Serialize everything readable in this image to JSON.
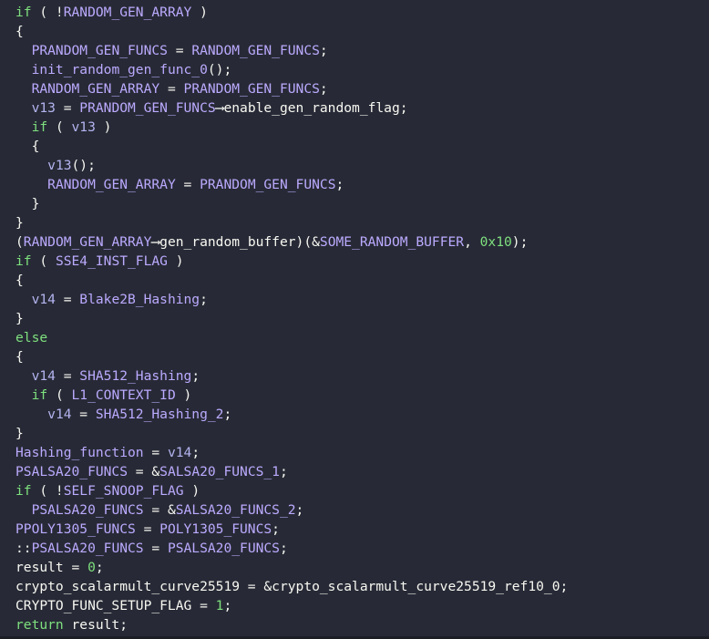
{
  "code": {
    "lines": [
      [
        {
          "t": "if",
          "c": "kw"
        },
        {
          "t": " ( !",
          "c": "pl"
        },
        {
          "t": "RANDOM_GEN_ARRAY",
          "c": "gv"
        },
        {
          "t": " )",
          "c": "pl"
        }
      ],
      [
        {
          "t": "{",
          "c": "pl"
        }
      ],
      [
        {
          "t": "  ",
          "c": "pl"
        },
        {
          "t": "PRANDOM_GEN_FUNCS",
          "c": "gv"
        },
        {
          "t": " = ",
          "c": "pl"
        },
        {
          "t": "RANDOM_GEN_FUNCS",
          "c": "gv"
        },
        {
          "t": ";",
          "c": "pl"
        }
      ],
      [
        {
          "t": "  ",
          "c": "pl"
        },
        {
          "t": "init_random_gen_func_0",
          "c": "gv"
        },
        {
          "t": "();",
          "c": "pl"
        }
      ],
      [
        {
          "t": "  ",
          "c": "pl"
        },
        {
          "t": "RANDOM_GEN_ARRAY",
          "c": "gv"
        },
        {
          "t": " = ",
          "c": "pl"
        },
        {
          "t": "PRANDOM_GEN_FUNCS",
          "c": "gv"
        },
        {
          "t": ";",
          "c": "pl"
        }
      ],
      [
        {
          "t": "  ",
          "c": "pl"
        },
        {
          "t": "v13",
          "c": "lv"
        },
        {
          "t": " = ",
          "c": "pl"
        },
        {
          "t": "PRANDOM_GEN_FUNCS",
          "c": "gv"
        },
        {
          "t": "⟶enable_gen_random_flag;",
          "c": "pl"
        }
      ],
      [
        {
          "t": "  ",
          "c": "pl"
        },
        {
          "t": "if",
          "c": "kw"
        },
        {
          "t": " ( ",
          "c": "pl"
        },
        {
          "t": "v13",
          "c": "lv"
        },
        {
          "t": " )",
          "c": "pl"
        }
      ],
      [
        {
          "t": "  {",
          "c": "pl"
        }
      ],
      [
        {
          "t": "    ",
          "c": "pl"
        },
        {
          "t": "v13",
          "c": "lv"
        },
        {
          "t": "();",
          "c": "pl"
        }
      ],
      [
        {
          "t": "    ",
          "c": "pl"
        },
        {
          "t": "RANDOM_GEN_ARRAY",
          "c": "gv"
        },
        {
          "t": " = ",
          "c": "pl"
        },
        {
          "t": "PRANDOM_GEN_FUNCS",
          "c": "gv"
        },
        {
          "t": ";",
          "c": "pl"
        }
      ],
      [
        {
          "t": "  }",
          "c": "pl"
        }
      ],
      [
        {
          "t": "}",
          "c": "pl"
        }
      ],
      [
        {
          "t": "(",
          "c": "pl"
        },
        {
          "t": "RANDOM_GEN_ARRAY",
          "c": "gv"
        },
        {
          "t": "⟶gen_random_buffer)(&",
          "c": "pl"
        },
        {
          "t": "SOME_RANDOM_BUFFER",
          "c": "gv"
        },
        {
          "t": ", ",
          "c": "pl"
        },
        {
          "t": "0x10",
          "c": "num"
        },
        {
          "t": ");",
          "c": "pl"
        }
      ],
      [
        {
          "t": "if",
          "c": "kw"
        },
        {
          "t": " ( ",
          "c": "pl"
        },
        {
          "t": "SSE4_INST_FLAG",
          "c": "gv"
        },
        {
          "t": " )",
          "c": "pl"
        }
      ],
      [
        {
          "t": "{",
          "c": "pl"
        }
      ],
      [
        {
          "t": "  ",
          "c": "pl"
        },
        {
          "t": "v14",
          "c": "lv"
        },
        {
          "t": " = ",
          "c": "pl"
        },
        {
          "t": "Blake2B_Hashing",
          "c": "gv"
        },
        {
          "t": ";",
          "c": "pl"
        }
      ],
      [
        {
          "t": "}",
          "c": "pl"
        }
      ],
      [
        {
          "t": "else",
          "c": "kw"
        }
      ],
      [
        {
          "t": "{",
          "c": "pl"
        }
      ],
      [
        {
          "t": "  ",
          "c": "pl"
        },
        {
          "t": "v14",
          "c": "lv"
        },
        {
          "t": " = ",
          "c": "pl"
        },
        {
          "t": "SHA512_Hashing",
          "c": "gv"
        },
        {
          "t": ";",
          "c": "pl"
        }
      ],
      [
        {
          "t": "  ",
          "c": "pl"
        },
        {
          "t": "if",
          "c": "kw"
        },
        {
          "t": " ( ",
          "c": "pl"
        },
        {
          "t": "L1_CONTEXT_ID",
          "c": "gv"
        },
        {
          "t": " )",
          "c": "pl"
        }
      ],
      [
        {
          "t": "    ",
          "c": "pl"
        },
        {
          "t": "v14",
          "c": "lv"
        },
        {
          "t": " = ",
          "c": "pl"
        },
        {
          "t": "SHA512_Hashing_2",
          "c": "gv"
        },
        {
          "t": ";",
          "c": "pl"
        }
      ],
      [
        {
          "t": "}",
          "c": "pl"
        }
      ],
      [
        {
          "t": "Hashing_function",
          "c": "gv"
        },
        {
          "t": " = ",
          "c": "pl"
        },
        {
          "t": "v14",
          "c": "lv"
        },
        {
          "t": ";",
          "c": "pl"
        }
      ],
      [
        {
          "t": "PSALSA20_FUNCS",
          "c": "gv"
        },
        {
          "t": " = &",
          "c": "pl"
        },
        {
          "t": "SALSA20_FUNCS_1",
          "c": "gv"
        },
        {
          "t": ";",
          "c": "pl"
        }
      ],
      [
        {
          "t": "if",
          "c": "kw"
        },
        {
          "t": " ( !",
          "c": "pl"
        },
        {
          "t": "SELF_SNOOP_FLAG",
          "c": "gv"
        },
        {
          "t": " )",
          "c": "pl"
        }
      ],
      [
        {
          "t": "  ",
          "c": "pl"
        },
        {
          "t": "PSALSA20_FUNCS",
          "c": "gv"
        },
        {
          "t": " = &",
          "c": "pl"
        },
        {
          "t": "SALSA20_FUNCS_2",
          "c": "gv"
        },
        {
          "t": ";",
          "c": "pl"
        }
      ],
      [
        {
          "t": "PPOLY1305_FUNCS",
          "c": "gv"
        },
        {
          "t": " = ",
          "c": "pl"
        },
        {
          "t": "POLY1305_FUNCS",
          "c": "gv"
        },
        {
          "t": ";",
          "c": "pl"
        }
      ],
      [
        {
          "t": "::",
          "c": "pl"
        },
        {
          "t": "PSALSA20_FUNCS",
          "c": "gv"
        },
        {
          "t": " = ",
          "c": "pl"
        },
        {
          "t": "PSALSA20_FUNCS",
          "c": "gv"
        },
        {
          "t": ";",
          "c": "pl"
        }
      ],
      [
        {
          "t": "result",
          "c": "pl"
        },
        {
          "t": " = ",
          "c": "pl"
        },
        {
          "t": "0",
          "c": "num"
        },
        {
          "t": ";",
          "c": "pl"
        }
      ],
      [
        {
          "t": "crypto_scalarmult_curve25519",
          "c": "pl"
        },
        {
          "t": " = &",
          "c": "pl"
        },
        {
          "t": "crypto_scalarmult_curve25519_ref10_0",
          "c": "fn"
        },
        {
          "t": ";",
          "c": "pl"
        }
      ],
      [
        {
          "t": "CRYPTO_FUNC_SETUP_FLAG",
          "c": "pl"
        },
        {
          "t": " = ",
          "c": "pl"
        },
        {
          "t": "1",
          "c": "num"
        },
        {
          "t": ";",
          "c": "pl"
        }
      ],
      [
        {
          "t": "return",
          "c": "kw"
        },
        {
          "t": " result;",
          "c": "pl"
        }
      ]
    ]
  }
}
